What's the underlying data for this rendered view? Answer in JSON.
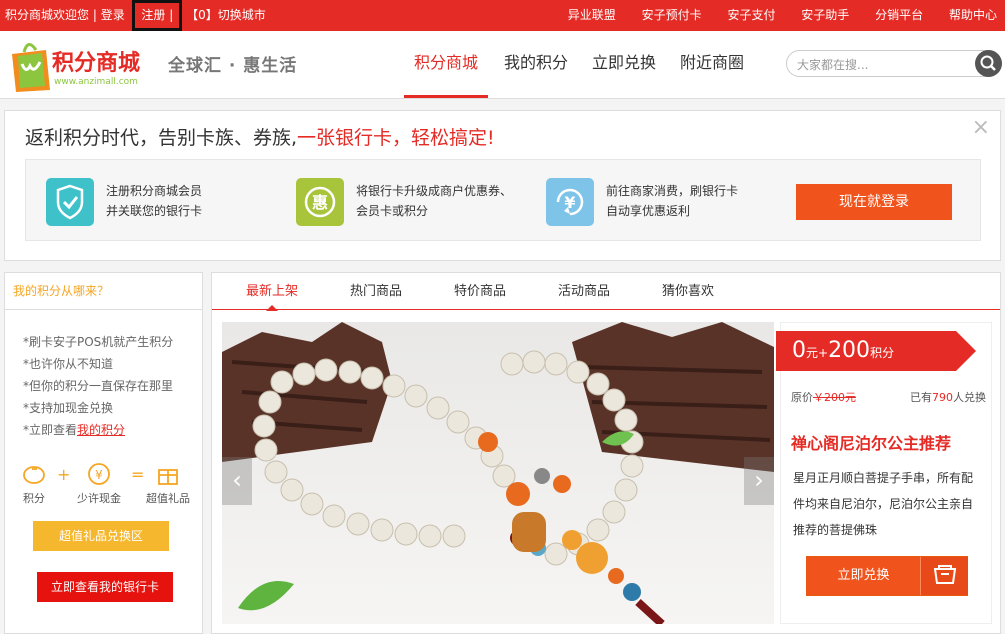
{
  "topbar": {
    "welcome": "积分商城欢迎您",
    "login": "登录",
    "register": "注册",
    "city": "【0】切换城市",
    "links": [
      "异业联盟",
      "安子预付卡",
      "安子支付",
      "安子助手",
      "分销平台",
      "帮助中心"
    ]
  },
  "header": {
    "logo_text": "积分商城",
    "logo_url": "www.anzimall.com",
    "slogan": "全球汇 · 惠生活",
    "nav": [
      "积分商城",
      "我的积分",
      "立即兑换",
      "附近商圈"
    ],
    "search_placeholder": "大家都在搜..."
  },
  "promo": {
    "title_plain": "返利积分时代，告别卡族、券族,",
    "title_red": "一张银行卡，轻松搞定!",
    "close": "×",
    "steps": [
      {
        "line1": "注册积分商城会员",
        "line2": "并关联您的银行卡",
        "icon": "shield-check-icon"
      },
      {
        "line1": "将银行卡升级成商户优惠券、",
        "line2": "会员卡或积分",
        "icon": "hui-coupon-icon"
      },
      {
        "line1": "前往商家消费，刷银行卡",
        "line2": "自动享优惠返利",
        "icon": "yen-refund-icon"
      }
    ],
    "login_button": "现在就登录"
  },
  "sidebar": {
    "heading": "我的积分从哪来？",
    "tips": [
      "*刷卡安子POS机就产生积分",
      "*也许你从不知道",
      "*但你的积分一直保存在那里",
      "*支持加现金兑换",
      "*立即查看"
    ],
    "tip_link": "我的积分",
    "formula": [
      "积分",
      "少许现金",
      "超值礼品"
    ],
    "btn_gift": "超值礼品兑换区",
    "btn_card": "立即查看我的银行卡"
  },
  "main": {
    "tabs": [
      "最新上架",
      "热门商品",
      "特价商品",
      "活动商品",
      "猜你喜欢"
    ],
    "product": {
      "price_cash": "0",
      "price_cash_unit": "元+",
      "price_points": "200",
      "price_points_unit": "积分",
      "orig_label": "原价",
      "orig_price": "￥200元",
      "sold_prefix": "已有",
      "sold_count": "790",
      "sold_suffix": "人兑换",
      "name": "禅心阁尼泊尔公主推荐",
      "desc": "星月正月顺白菩提子手串，所有配件均来自尼泊尔，尼泊尔公主亲自推荐的菩提佛珠",
      "buy_button": "立即兑换"
    }
  },
  "colors": {
    "brand_red": "#e52b25",
    "orange": "#f1531d",
    "yellow": "#f5b72e"
  }
}
